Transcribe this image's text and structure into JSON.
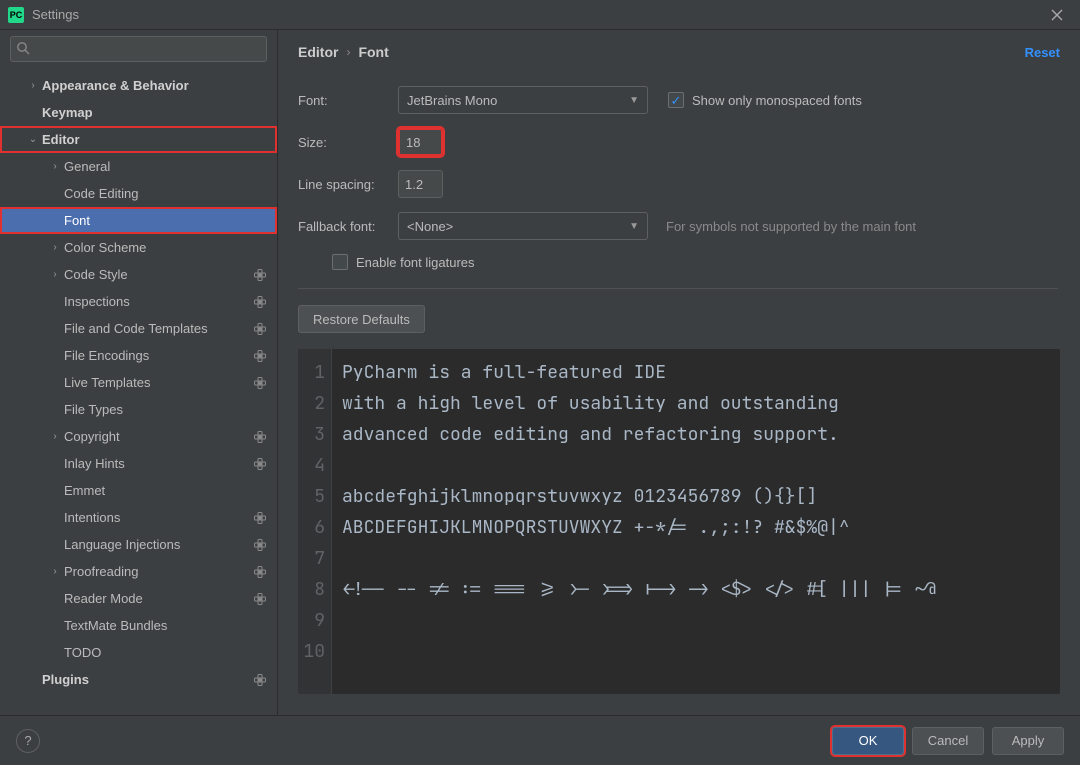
{
  "window": {
    "title": "Settings"
  },
  "search": {
    "placeholder": ""
  },
  "sidebar": {
    "items": [
      {
        "label": "Appearance & Behavior",
        "indent": 26,
        "twisty": "right",
        "bold": true
      },
      {
        "label": "Keymap",
        "indent": 26,
        "twisty": "none",
        "bold": true
      },
      {
        "label": "Editor",
        "indent": 26,
        "twisty": "down",
        "bold": true,
        "red": true
      },
      {
        "label": "General",
        "indent": 48,
        "twisty": "right"
      },
      {
        "label": "Code Editing",
        "indent": 48,
        "twisty": "none"
      },
      {
        "label": "Font",
        "indent": 48,
        "twisty": "none",
        "selected": true,
        "red": true
      },
      {
        "label": "Color Scheme",
        "indent": 48,
        "twisty": "right"
      },
      {
        "label": "Code Style",
        "indent": 48,
        "twisty": "right",
        "gear": true
      },
      {
        "label": "Inspections",
        "indent": 48,
        "twisty": "none",
        "gear": true
      },
      {
        "label": "File and Code Templates",
        "indent": 48,
        "twisty": "none",
        "gear": true
      },
      {
        "label": "File Encodings",
        "indent": 48,
        "twisty": "none",
        "gear": true
      },
      {
        "label": "Live Templates",
        "indent": 48,
        "twisty": "none",
        "gear": true
      },
      {
        "label": "File Types",
        "indent": 48,
        "twisty": "none"
      },
      {
        "label": "Copyright",
        "indent": 48,
        "twisty": "right",
        "gear": true
      },
      {
        "label": "Inlay Hints",
        "indent": 48,
        "twisty": "none",
        "gear": true
      },
      {
        "label": "Emmet",
        "indent": 48,
        "twisty": "none"
      },
      {
        "label": "Intentions",
        "indent": 48,
        "twisty": "none",
        "gear": true
      },
      {
        "label": "Language Injections",
        "indent": 48,
        "twisty": "none",
        "gear": true
      },
      {
        "label": "Proofreading",
        "indent": 48,
        "twisty": "right",
        "gear": true
      },
      {
        "label": "Reader Mode",
        "indent": 48,
        "twisty": "none",
        "gear": true
      },
      {
        "label": "TextMate Bundles",
        "indent": 48,
        "twisty": "none"
      },
      {
        "label": "TODO",
        "indent": 48,
        "twisty": "none"
      },
      {
        "label": "Plugins",
        "indent": 26,
        "twisty": "none",
        "bold": true,
        "gear": true
      }
    ]
  },
  "breadcrumb": {
    "root": "Editor",
    "leaf": "Font"
  },
  "reset": "Reset",
  "form": {
    "font_label": "Font:",
    "font_value": "JetBrains Mono",
    "monospace_label": "Show only monospaced fonts",
    "monospace_checked": true,
    "size_label": "Size:",
    "size_value": "18",
    "line_spacing_label": "Line spacing:",
    "line_spacing_value": "1.2",
    "fallback_label": "Fallback font:",
    "fallback_value": "<None>",
    "fallback_hint": "For symbols not supported by the main font",
    "ligatures_label": "Enable font ligatures",
    "ligatures_checked": false,
    "restore_label": "Restore Defaults"
  },
  "preview": {
    "lines": [
      "PyCharm is a full-featured IDE",
      "with a high level of usability and outstanding",
      "advanced code editing and refactoring support.",
      "",
      "abcdefghijklmnopqrstuvwxyz 0123456789 (){}[]",
      "ABCDEFGHIJKLMNOPQRSTUVWXYZ +-*/= .,;:!? #&$%@|^",
      "",
      "<!-- -- != := === >= >- >=> |-> -> <$> </> #[ ||| |= ~@",
      "",
      ""
    ]
  },
  "footer": {
    "ok": "OK",
    "cancel": "Cancel",
    "apply": "Apply"
  }
}
